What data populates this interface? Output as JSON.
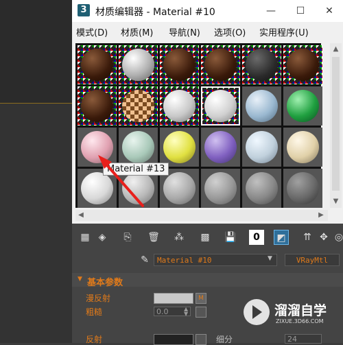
{
  "window": {
    "app_icon_text": "3",
    "title": "材质编辑器 - Material #10",
    "controls": [
      "—",
      "☐",
      "✕"
    ]
  },
  "menu": [
    "模式(D)",
    "材质(M)",
    "导航(N)",
    "选项(O)",
    "实用程序(U)"
  ],
  "slots": {
    "items": [
      {
        "bg": "check",
        "fill": "radial-gradient(circle at 35% 30%, #8a5a3a, #3a1a0a 60%, #1a0a00)"
      },
      {
        "bg": "check",
        "fill": "radial-gradient(circle at 35% 30%, #ffffff, #b0b0b0 55%, #606060)"
      },
      {
        "bg": "check",
        "fill": "radial-gradient(circle at 35% 30%, #8a5a3a, #3a1a0a 60%, #1a0a00)"
      },
      {
        "bg": "check",
        "fill": "radial-gradient(circle at 35% 30%, #8a5a3a, #3a1a0a 60%, #1a0a00)"
      },
      {
        "bg": "check",
        "fill": "radial-gradient(circle at 35% 30%, #6a6a6a, #2a2a2a 60%, #111)"
      },
      {
        "bg": "check",
        "fill": "radial-gradient(circle at 35% 30%, #8a5a3a, #3a1a0a 60%, #1a0a00)"
      },
      {
        "bg": "check",
        "fill": "radial-gradient(circle at 35% 30%, #8a5a3a, #3a1a0a 60%, #1a0a00)"
      },
      {
        "bg": "check",
        "fill": "repeating-conic-gradient(#f0c090 0 25%, #7a4a20 0 50%) 0 0/12px 12px"
      },
      {
        "bg": "check",
        "fill": "radial-gradient(circle at 35% 30%, #ffffff, #c8c8c8 55%, #707070)"
      },
      {
        "bg": "check",
        "fill": "radial-gradient(circle at 35% 30%, #ffffff, #d0d0d0 55%, #808080)"
      },
      {
        "bg": "plain",
        "fill": "radial-gradient(circle at 35% 30%, #e8f0f8, #9ab8d0 55%, #506a80)"
      },
      {
        "bg": "plain",
        "fill": "radial-gradient(circle at 35% 30%, #a0f0b0, #20a040 55%, #0a5020)"
      },
      {
        "bg": "plain",
        "fill": "radial-gradient(circle at 35% 30%, #ffe8ee, #e0a0b0 55%, #806068)"
      },
      {
        "bg": "plain",
        "fill": "radial-gradient(circle at 35% 30%, #e8f4ee, #a8c8b8 55%, #607068)"
      },
      {
        "bg": "plain",
        "fill": "radial-gradient(circle at 35% 30%, #ffffc0, #e0e040 55%, #807820)"
      },
      {
        "bg": "plain",
        "fill": "radial-gradient(circle at 35% 30%, #d0c0f0, #8060c0 55%, #403070)"
      },
      {
        "bg": "plain",
        "fill": "radial-gradient(circle at 35% 30%, #f0f8ff, #c0d0dc 55%, #708090)"
      },
      {
        "bg": "plain",
        "fill": "radial-gradient(circle at 35% 30%, #fff8e8, #e0d0a8 55%, #807458)"
      },
      {
        "bg": "plain",
        "fill": "radial-gradient(circle at 35% 30%, #ffffff, #d8d8d8 55%, #808080)"
      },
      {
        "bg": "plain",
        "fill": "radial-gradient(circle at 35% 30%, #f0f0f0, #b8b8b8 55%, #707070)"
      },
      {
        "bg": "plain",
        "fill": "radial-gradient(circle at 35% 30%, #e0e0e0, #a8a8a8 55%, #606060)"
      },
      {
        "bg": "plain",
        "fill": "radial-gradient(circle at 35% 30%, #d0d0d0, #989898 55%, #585858)"
      },
      {
        "bg": "plain",
        "fill": "radial-gradient(circle at 35% 30%, #c0c0c0, #888888 55%, #484848)"
      },
      {
        "bg": "plain",
        "fill": "radial-gradient(circle at 35% 30%, #a0a0a0, #686868 55%, #303030)"
      }
    ]
  },
  "tooltip": "Material #13",
  "material": {
    "name": "Material #10",
    "type": "VRayMtl"
  },
  "rollout": {
    "title": "基本参数",
    "diffuse_label": "漫反射",
    "diffuse_map": "M",
    "roughness_label": "粗糙",
    "roughness_value": "0.0",
    "reflect_label": "反射",
    "subdivs_label": "细分",
    "subdivs_value": "24"
  },
  "watermark": {
    "name": "溜溜自学",
    "url": "ZIXUE.3D66.COM"
  },
  "colors": {
    "accent": "#e07a1a",
    "panel_bg": "#444444",
    "active_tool": "#2f6f9a"
  }
}
